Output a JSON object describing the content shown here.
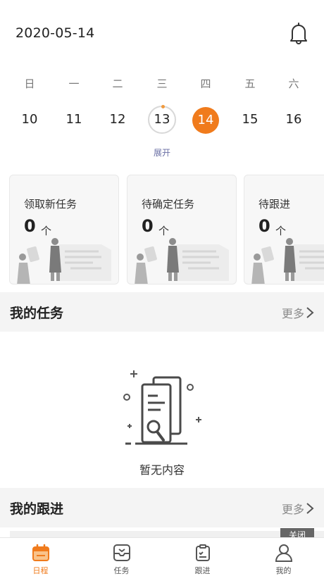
{
  "header": {
    "date": "2020-05-14"
  },
  "week": {
    "days": [
      "日",
      "一",
      "二",
      "三",
      "四",
      "五",
      "六"
    ],
    "dates": [
      "10",
      "11",
      "12",
      "13",
      "14",
      "15",
      "16"
    ],
    "expand_label": "展开"
  },
  "summary_cards": [
    {
      "title": "领取新任务",
      "count": "0",
      "unit": "个"
    },
    {
      "title": "待确定任务",
      "count": "0",
      "unit": "个"
    },
    {
      "title": "待跟进",
      "count": "0",
      "unit": "个"
    }
  ],
  "my_tasks": {
    "title": "我的任务",
    "more_label": "更多",
    "empty_text": "暂无内容"
  },
  "my_followups": {
    "title": "我的跟进",
    "more_label": "更多",
    "close_label": "关闭"
  },
  "tabbar": {
    "items": [
      {
        "label": "日程",
        "icon": "calendar-icon"
      },
      {
        "label": "任务",
        "icon": "inbox-icon"
      },
      {
        "label": "跟进",
        "icon": "clipboard-icon"
      },
      {
        "label": "我的",
        "icon": "user-icon"
      }
    ]
  },
  "colors": {
    "accent": "#f07b1c",
    "link": "#6a6fa4",
    "section_bg": "#f4f4f4"
  }
}
